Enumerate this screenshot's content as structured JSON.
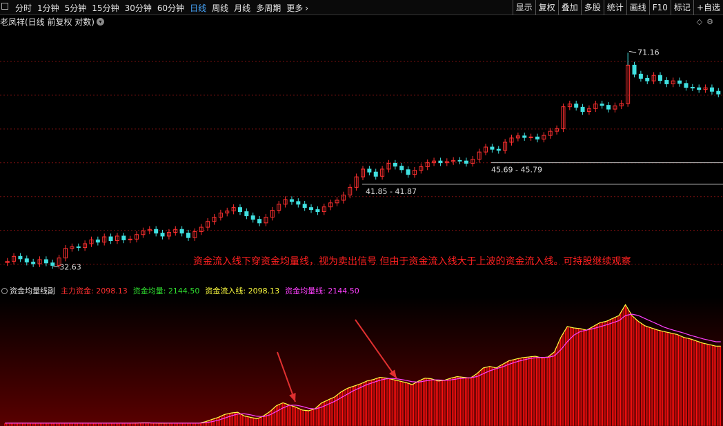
{
  "toolbar": {
    "periods": [
      "分时",
      "1分钟",
      "5分钟",
      "15分钟",
      "30分钟",
      "60分钟",
      "日线",
      "周线",
      "月线",
      "多周期",
      "更多"
    ],
    "active_period": "日线",
    "tools": [
      "显示",
      "复权",
      "叠加",
      "多股",
      "统计",
      "画线",
      "F10",
      "标记",
      "+自选"
    ]
  },
  "stock": {
    "title": "老凤祥(日线 前复权 对数)"
  },
  "annotations": {
    "text": "资金流入线下穿资金均量线，视为卖出信号 但由于资金流入线大于上波的资金流入线。可持股继续观察",
    "high_label": "71.16",
    "low_label": "32.63",
    "line1_label": "45.69 - 45.79",
    "line2_label": "41.85 - 41.87"
  },
  "indicator": {
    "name": "资金均量线副",
    "fields": [
      {
        "label": "主力资金: 2098.13",
        "color": "#ff3030"
      },
      {
        "label": "资金均量: 2144.50",
        "color": "#30e030"
      },
      {
        "label": "资金流入线: 2098.13",
        "color": "#ffff40"
      },
      {
        "label": "资金均量线: 2144.50",
        "color": "#ff40ff"
      }
    ]
  },
  "colors": {
    "up": "#ff3030",
    "down": "#40e0e0",
    "grid": "#7a1010",
    "bar": "#ff1010",
    "inflow": "#ffff40",
    "avg": "#ff40ff"
  },
  "chart_data": [
    {
      "type": "candlestick",
      "title": "老凤祥",
      "scale": "log",
      "ylim": [
        30.5,
        78
      ],
      "closes": [
        33.2,
        33.8,
        33.5,
        33.1,
        32.9,
        33.4,
        33.0,
        32.7,
        33.6,
        34.8,
        35.0,
        34.9,
        35.4,
        35.9,
        35.6,
        36.3,
        35.8,
        36.4,
        35.9,
        36.0,
        36.6,
        37.1,
        37.3,
        36.8,
        36.4,
        36.9,
        37.3,
        36.8,
        36.2,
        37.0,
        37.6,
        38.4,
        39.0,
        39.6,
        39.9,
        40.4,
        39.8,
        39.2,
        38.7,
        38.2,
        39.0,
        40.0,
        40.9,
        41.6,
        41.3,
        40.9,
        40.4,
        40.1,
        39.8,
        40.5,
        41.1,
        41.5,
        42.3,
        43.5,
        45.2,
        46.5,
        46.0,
        45.3,
        46.5,
        47.5,
        47.0,
        46.4,
        45.6,
        46.3,
        46.9,
        47.6,
        47.9,
        47.6,
        47.8,
        48.0,
        47.9,
        47.5,
        48.2,
        49.5,
        50.4,
        50.0,
        49.8,
        51.3,
        52.1,
        52.5,
        52.2,
        52.3,
        51.9,
        52.6,
        53.4,
        53.9,
        58.4,
        59.0,
        58.3,
        57.4,
        58.0,
        59.0,
        58.7,
        57.9,
        58.6,
        59.1,
        68.0,
        65.8,
        64.8,
        64.2,
        65.5,
        64.3,
        63.5,
        64.2,
        63.6,
        62.7,
        62.6,
        62.2,
        62.6,
        61.8,
        61.2
      ],
      "high": 71.16,
      "low": 32.63,
      "hlines": [
        {
          "label": "45.69 - 45.79"
        },
        {
          "label": "41.85 - 41.87"
        }
      ]
    },
    {
      "type": "bar",
      "title": "资金均量线副",
      "series": [
        {
          "name": "主力资金",
          "values": [
            20,
            20,
            20,
            20,
            20,
            20,
            20,
            20,
            20,
            20,
            20,
            20,
            20,
            20,
            20,
            20,
            20,
            20,
            20,
            20,
            22,
            24,
            25,
            22,
            20,
            20,
            20,
            20,
            20,
            20,
            20,
            40,
            70,
            100,
            140,
            160,
            170,
            120,
            100,
            80,
            120,
            180,
            260,
            300,
            270,
            240,
            200,
            190,
            220,
            300,
            340,
            380,
            450,
            500,
            530,
            560,
            600,
            620,
            650,
            640,
            620,
            600,
            580,
            550,
            600,
            640,
            630,
            600,
            610,
            640,
            660,
            650,
            640,
            700,
            780,
            800,
            780,
            830,
            880,
            900,
            920,
            930,
            940,
            920,
            930,
            1000,
            1200,
            1350,
            1330,
            1320,
            1300,
            1350,
            1400,
            1420,
            1460,
            1500,
            1650,
            1500,
            1420,
            1360,
            1330,
            1300,
            1280,
            1260,
            1240,
            1200,
            1180,
            1150,
            1120,
            1100,
            1080
          ]
        },
        {
          "name": "资金流入线",
          "values": [
            20,
            20,
            20,
            20,
            20,
            20,
            20,
            20,
            20,
            20,
            20,
            20,
            20,
            20,
            20,
            20,
            20,
            20,
            20,
            20,
            22,
            24,
            25,
            22,
            20,
            20,
            20,
            20,
            20,
            20,
            20,
            40,
            70,
            100,
            140,
            160,
            170,
            120,
            100,
            80,
            120,
            180,
            260,
            300,
            270,
            240,
            200,
            190,
            220,
            300,
            340,
            380,
            450,
            500,
            530,
            560,
            600,
            620,
            650,
            640,
            620,
            600,
            580,
            550,
            600,
            640,
            630,
            600,
            610,
            640,
            660,
            650,
            640,
            700,
            780,
            800,
            780,
            830,
            880,
            900,
            920,
            930,
            940,
            920,
            930,
            1000,
            1200,
            1350,
            1330,
            1320,
            1300,
            1350,
            1400,
            1420,
            1460,
            1500,
            1650,
            1500,
            1420,
            1360,
            1330,
            1300,
            1280,
            1260,
            1240,
            1200,
            1180,
            1150,
            1120,
            1100,
            1080
          ]
        },
        {
          "name": "资金均量线",
          "values": [
            20,
            20,
            20,
            20,
            20,
            20,
            20,
            20,
            20,
            20,
            20,
            20,
            20,
            20,
            20,
            20,
            20,
            20,
            20,
            20,
            21,
            22,
            23,
            23,
            22,
            21,
            20,
            20,
            20,
            20,
            20,
            26,
            40,
            60,
            90,
            120,
            145,
            150,
            135,
            115,
            110,
            135,
            180,
            230,
            265,
            268,
            250,
            225,
            215,
            240,
            280,
            320,
            370,
            420,
            470,
            510,
            550,
            580,
            610,
            630,
            635,
            625,
            610,
            590,
            585,
            600,
            615,
            615,
            610,
            615,
            630,
            640,
            645,
            660,
            700,
            740,
            770,
            795,
            830,
            860,
            885,
            905,
            920,
            925,
            925,
            945,
            1030,
            1140,
            1230,
            1280,
            1300,
            1320,
            1345,
            1370,
            1400,
            1430,
            1500,
            1520,
            1500,
            1460,
            1420,
            1380,
            1340,
            1310,
            1285,
            1260,
            1230,
            1205,
            1180,
            1160,
            1140
          ]
        }
      ]
    }
  ]
}
